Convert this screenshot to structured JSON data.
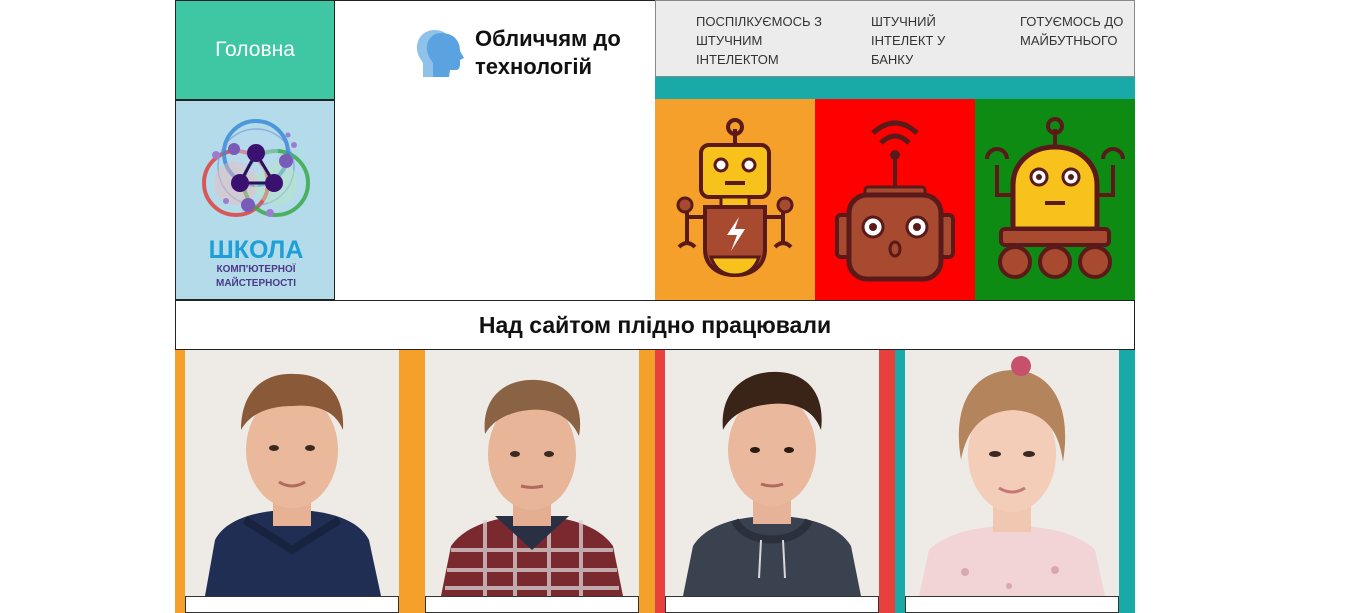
{
  "header": {
    "home_label": "Головна",
    "brand_title": "Обличчям до технологій",
    "brand_icon": "head-profile-icon"
  },
  "nav": {
    "items": [
      {
        "label": "ПОСПІЛКУЄМОСЬ З ШТУЧНИМ ІНТЕЛЕКТОМ"
      },
      {
        "label": "ШТУЧНИЙ ІНТЕЛЕКТ У БАНКУ"
      },
      {
        "label": "ГОТУЄМОСЬ ДО МАЙБУТНЬОГО"
      }
    ]
  },
  "logo": {
    "line1": "ШКОЛА",
    "line2": "КОМП'ЮТЕРНОЇ",
    "line3": "МАЙСТЕРНОСТІ"
  },
  "tiles": [
    {
      "icon": "robot-lightning-icon",
      "color": "#f5a02a"
    },
    {
      "icon": "robot-antenna-icon",
      "color": "#ff0000"
    },
    {
      "icon": "robot-wheels-icon",
      "color": "#0e8b13"
    }
  ],
  "team": {
    "heading": "Над сайтом плідно працювали",
    "members": [
      {
        "photo": "boy-navy-hoodie",
        "accent": "#f5a02a"
      },
      {
        "photo": "boy-plaid-shirt",
        "accent": "#f5a02a"
      },
      {
        "photo": "boy-grey-hoodie",
        "accent": "#e8403c"
      },
      {
        "photo": "girl-pink-sweater",
        "accent": "#19aaa8"
      }
    ]
  },
  "colors": {
    "home": "#3ec7a2",
    "nav_strip": "#19aaa8",
    "logo_bg": "#b4dbe9"
  }
}
